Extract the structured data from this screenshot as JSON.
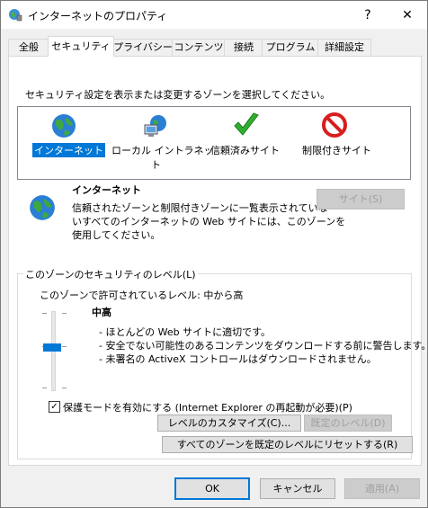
{
  "window": {
    "title": "インターネットのプロパティ",
    "help": "?",
    "close": "✕"
  },
  "tabs": [
    "全般",
    "セキュリティ",
    "プライバシー",
    "コンテンツ",
    "接続",
    "プログラム",
    "詳細設定"
  ],
  "security": {
    "instruction": "セキュリティ設定を表示または変更するゾーンを選択してください。",
    "zones": [
      {
        "label": "インターネット",
        "icon": "globe-icon"
      },
      {
        "label_line1": "ローカル イントラネッ",
        "label_line2": "ト",
        "icon": "intranet-icon"
      },
      {
        "label": "信頼済みサイト",
        "icon": "checkmark-icon"
      },
      {
        "label": "制限付きサイト",
        "icon": "prohibited-icon"
      }
    ],
    "zone_title": "インターネット",
    "zone_desc_1": "信頼されたゾーンと制限付きゾーンに一覧表示されていな",
    "zone_desc_2": "いすべてのインターネットの Web サイトには、このゾーンを",
    "zone_desc_3": "使用してください。",
    "sites_button": "サイト(S)",
    "group_title": "このゾーンのセキュリティのレベル(L)",
    "allowed_levels": "このゾーンで許可されているレベル: 中から高",
    "level_name": "中高",
    "level_desc_1": "- ほとんどの Web サイトに適切です。",
    "level_desc_2": "- 安全でない可能性のあるコンテンツをダウンロードする前に警告します。",
    "level_desc_3": "- 未署名の ActiveX コントロールはダウンロードされません。",
    "protected_mode_label": "保護モードを有効にする (Internet Explorer の再起動が必要)(P)",
    "protected_mode_checked": true,
    "custom_level_button": "レベルのカスタマイズ(C)...",
    "default_level_button": "既定のレベル(D)",
    "reset_all_button": "すべてのゾーンを既定のレベルにリセットする(R)"
  },
  "footer": {
    "ok": "OK",
    "cancel": "キャンセル",
    "apply": "適用(A)"
  },
  "colors": {
    "accent": "#0078d7",
    "disabled_text": "#a0a0a0",
    "prohibited": "#d81e1e",
    "check": "#2fae2f"
  }
}
